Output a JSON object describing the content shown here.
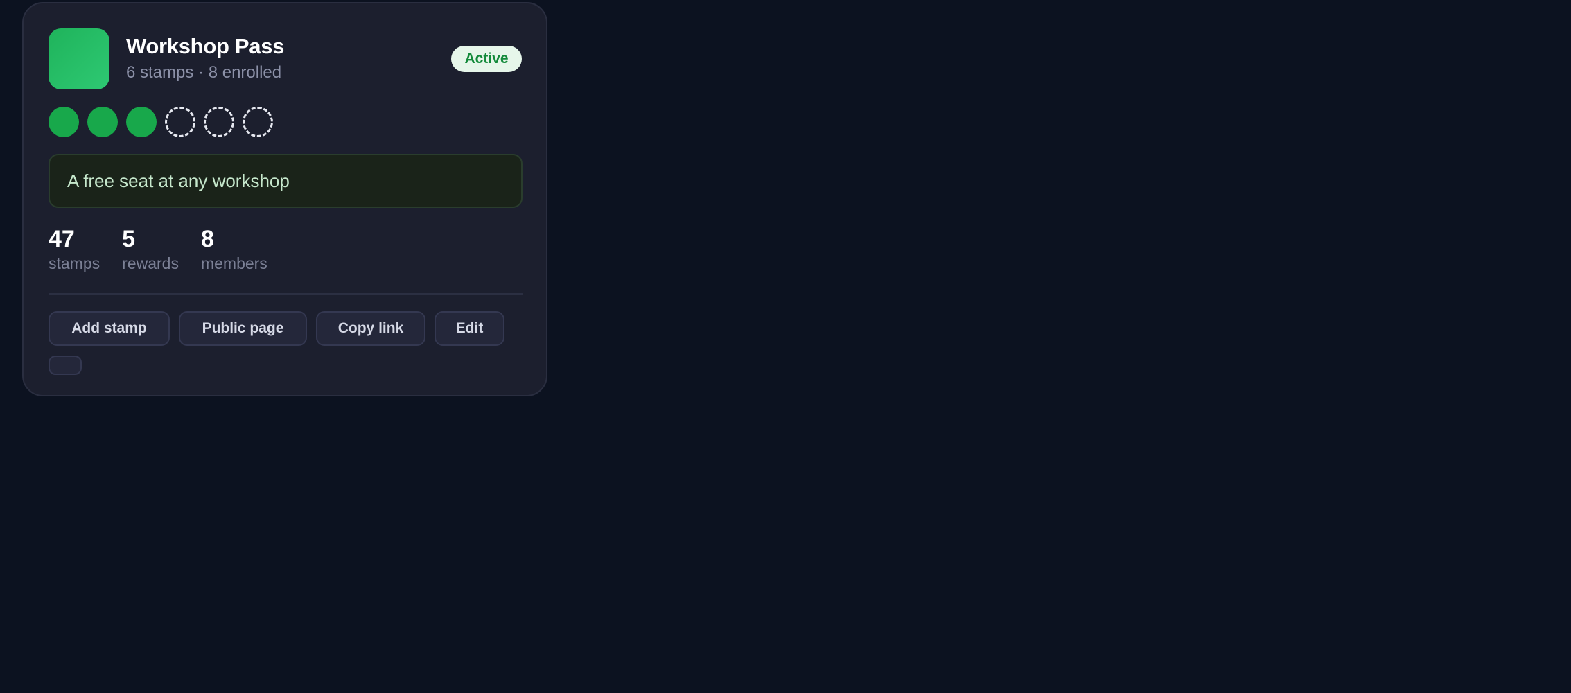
{
  "card": {
    "title": "Workshop Pass",
    "subtitle": "6 stamps · 8 enrolled",
    "status": "Active",
    "logo_icon": "program-logo",
    "stamps": {
      "total": 6,
      "filled": 3
    },
    "reward": "A free seat at any workshop",
    "stats": [
      {
        "value": "47",
        "label": "stamps"
      },
      {
        "value": "5",
        "label": "rewards"
      },
      {
        "value": "8",
        "label": "members"
      }
    ],
    "actions": {
      "add_stamp": "Add stamp",
      "public_page": "Public page",
      "copy_link": "Copy link",
      "edit": "Edit"
    }
  },
  "colors": {
    "background": "#0c1220",
    "card": "#1c1f2e",
    "accent_green": "#18a84b",
    "badge_bg": "#e6f6ea",
    "badge_text": "#128a3a"
  }
}
